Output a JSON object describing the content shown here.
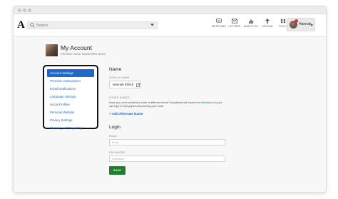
{
  "header": {
    "logo": "A",
    "search_placeholder": "Search",
    "nav": [
      {
        "label": "MENTIONS",
        "icon": "mentions-icon"
      },
      {
        "label": "LETTERS",
        "icon": "letters-icon"
      },
      {
        "label": "ANALYTICS",
        "icon": "analytics-icon"
      },
      {
        "label": "UPLOAD",
        "icon": "upload-icon"
      },
      {
        "label": "TOOLS",
        "icon": "tools-icon"
      }
    ],
    "user_name": "Hannah"
  },
  "profile": {
    "title": "My Account",
    "member_since": "Member since September 2013"
  },
  "sidebar": {
    "items": [
      {
        "label": "Account Settings",
        "active": true
      },
      {
        "label": "Premium Subscription"
      },
      {
        "label": "Email Notifications"
      },
      {
        "label": "Language Settings"
      },
      {
        "label": "Social Profiles"
      },
      {
        "label": "Personal Website"
      },
      {
        "label": "Privacy Settings"
      },
      {
        "label": "Blocking and Reporting"
      }
    ]
  },
  "name_section": {
    "title": "Name",
    "display_name_label": "DISPLAY NAME",
    "display_name_value": "Hannah Ehlich",
    "other_names_label": "OTHER NAMES",
    "help_text_1": "Have you ever published under a different name? Academia will search for",
    "help_link": "Mentions",
    "help_text_2": "of your name(s) to find papers discussing your work.",
    "add_alternate": "+ Add Alternate Name"
  },
  "login_section": {
    "title": "Login",
    "email_label": "EMAIL",
    "email_placeholder": "Email",
    "password_label": "PASSWORD",
    "password_placeholder": "Password",
    "save_label": "SAVE"
  },
  "colors": {
    "link": "#1d68c9",
    "save_button": "#1f7d2f",
    "badge": "#e0322a"
  }
}
